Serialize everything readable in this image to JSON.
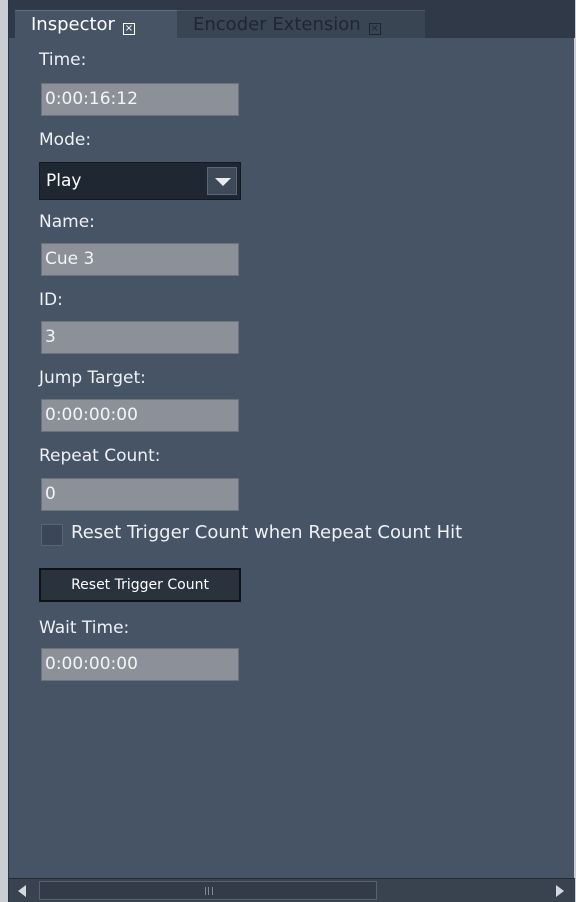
{
  "tabs": [
    {
      "label": "Inspector",
      "active": true,
      "close_icon": "close-box-icon"
    },
    {
      "label": "Encoder Extension",
      "active": false,
      "close_icon": "close-box-icon"
    }
  ],
  "fields": {
    "time": {
      "label": "Time:",
      "value": "0:00:16:12"
    },
    "mode": {
      "label": "Mode:",
      "value": "Play",
      "icon": "chevron-down-icon"
    },
    "name": {
      "label": "Name:",
      "value": "Cue 3"
    },
    "id": {
      "label": "ID:",
      "value": "3"
    },
    "jump_target": {
      "label": "Jump Target:",
      "value": "0:00:00:00"
    },
    "repeat_count": {
      "label": "Repeat Count:",
      "value": "0"
    },
    "reset_on_hit": {
      "label": "Reset Trigger Count when Repeat Count Hit",
      "checked": false
    },
    "reset_button": {
      "label": "Reset Trigger Count"
    },
    "wait_time": {
      "label": "Wait Time:",
      "value": "0:00:00:00"
    }
  },
  "scrollbar": {
    "left_icon": "arrow-left-icon",
    "right_icon": "arrow-right-icon",
    "grip_icon": "grip-icon"
  },
  "colors": {
    "panel_bg": "#465466",
    "field_bg": "#8c9098",
    "tab_strip": "#2f3947"
  }
}
